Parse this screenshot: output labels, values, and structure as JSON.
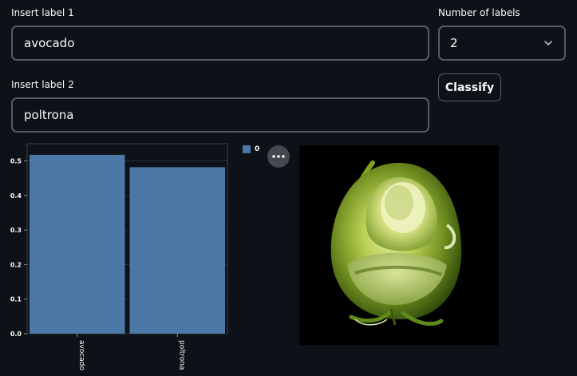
{
  "inputs": {
    "label1": {
      "label": "Insert label 1",
      "value": "avocado"
    },
    "label2": {
      "label": "Insert label 2",
      "value": "poltrona"
    }
  },
  "num_labels": {
    "label": "Number of labels",
    "value": "2"
  },
  "classify_label": "Classify",
  "legend": {
    "series_name": "0"
  },
  "chart_data": {
    "type": "bar",
    "categories": [
      "avocado",
      "poltrona"
    ],
    "series": [
      {
        "name": "0",
        "values": [
          0.518,
          0.482
        ]
      }
    ],
    "yticks": [
      "0.0",
      "0.1",
      "0.2",
      "0.3",
      "0.4",
      "0.5"
    ],
    "ylim": [
      0,
      0.55
    ],
    "xlabel": "",
    "ylabel": "",
    "grid": true,
    "legend_position": "top-right",
    "bar_color": "#4c78a8"
  },
  "image": {
    "icon": "avocado-chair-image"
  },
  "colors": {
    "background": "#0e1117",
    "border": "#555a66",
    "bar": "#4c78a8"
  }
}
